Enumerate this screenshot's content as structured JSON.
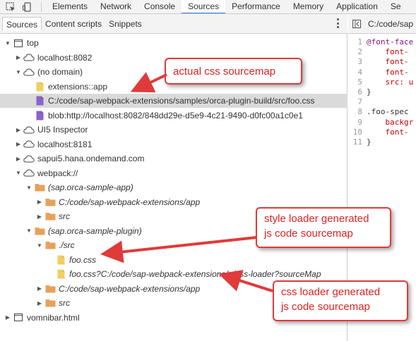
{
  "toolbar": {
    "tabs": [
      "Elements",
      "Network",
      "Console",
      "Sources",
      "Performance",
      "Memory",
      "Application",
      "Se"
    ],
    "active": "Sources"
  },
  "navigator": {
    "tabs": [
      "Sources",
      "Content scripts",
      "Snippets"
    ],
    "active": "Sources"
  },
  "tree": [
    {
      "label": "top",
      "depth": 0,
      "icon": "frame",
      "expanded": true
    },
    {
      "label": "localhost:8082",
      "depth": 1,
      "icon": "cloud",
      "expanded": false
    },
    {
      "label": "(no domain)",
      "depth": 1,
      "icon": "cloud",
      "expanded": true
    },
    {
      "label": "extensions::app",
      "depth": 2,
      "icon": "file-yellow"
    },
    {
      "label": "C:/code/sap-webpack-extensions/samples/orca-plugin-build/src/foo.css",
      "depth": 2,
      "icon": "file-purple",
      "selected": true
    },
    {
      "label": "blob:http://localhost:8082/848dd29e-d5e9-4c21-9490-d0fc00a1c0e1",
      "depth": 2,
      "icon": "file-purple"
    },
    {
      "label": "UI5 Inspector",
      "depth": 1,
      "icon": "cloud",
      "expanded": false
    },
    {
      "label": "localhost:8181",
      "depth": 1,
      "icon": "cloud",
      "expanded": false
    },
    {
      "label": "sapui5.hana.ondemand.com",
      "depth": 1,
      "icon": "cloud",
      "expanded": false
    },
    {
      "label": "webpack://",
      "depth": 1,
      "icon": "cloud",
      "expanded": true
    },
    {
      "label": "(sap.orca-sample-app)",
      "depth": 2,
      "icon": "folder",
      "expanded": true,
      "italic": true
    },
    {
      "label": "C:/code/sap-webpack-extensions/app",
      "depth": 3,
      "icon": "folder",
      "expanded": false,
      "italic": true
    },
    {
      "label": "src",
      "depth": 3,
      "icon": "folder",
      "expanded": false,
      "italic": true
    },
    {
      "label": "(sap.orca-sample-plugin)",
      "depth": 2,
      "icon": "folder",
      "expanded": true,
      "italic": true
    },
    {
      "label": "./src",
      "depth": 3,
      "icon": "folder",
      "expanded": true,
      "italic": true
    },
    {
      "label": "foo.css",
      "depth": 4,
      "icon": "file-yellow",
      "italic": true
    },
    {
      "label": "foo.css?C:/code/sap-webpack-extensions/~/css-loader?sourceMap",
      "depth": 4,
      "icon": "file-yellow",
      "italic": true
    },
    {
      "label": "C:/code/sap-webpack-extensions/app",
      "depth": 3,
      "icon": "folder",
      "expanded": false,
      "italic": true
    },
    {
      "label": "src",
      "depth": 3,
      "icon": "folder",
      "expanded": false,
      "italic": true
    },
    {
      "label": "vomnibar.html",
      "depth": 0,
      "icon": "frame",
      "expanded": false
    }
  ],
  "editor": {
    "file_tab": "C:/code/sap",
    "lines": [
      {
        "n": "1",
        "text": "@font-face",
        "kind": "sel"
      },
      {
        "n": "2",
        "text": "    font-",
        "kind": "prop"
      },
      {
        "n": "3",
        "text": "    font-",
        "kind": "prop"
      },
      {
        "n": "4",
        "text": "    font-",
        "kind": "prop"
      },
      {
        "n": "5",
        "text": "    src: u",
        "kind": "prop"
      },
      {
        "n": "6",
        "text": "}",
        "kind": "plain"
      },
      {
        "n": "7",
        "text": "",
        "kind": "plain"
      },
      {
        "n": "8",
        "text": ".foo-spec",
        "kind": "plain"
      },
      {
        "n": "9",
        "text": "    backgr",
        "kind": "prop"
      },
      {
        "n": "10",
        "text": "    font-",
        "kind": "prop"
      },
      {
        "n": "11",
        "text": "}",
        "kind": "plain"
      }
    ]
  },
  "callouts": {
    "css": "actual css sourcemap",
    "style": [
      "style loader generated",
      "js code sourcemap"
    ],
    "loader": [
      "css loader generated",
      "js code sourcemap"
    ]
  },
  "colors": {
    "accent": "#3879d9",
    "callout_red": "#e03a3a",
    "folder_orange": "#e8a15b",
    "file_yellow": "#f0d060",
    "file_purple": "#8b63c9"
  }
}
